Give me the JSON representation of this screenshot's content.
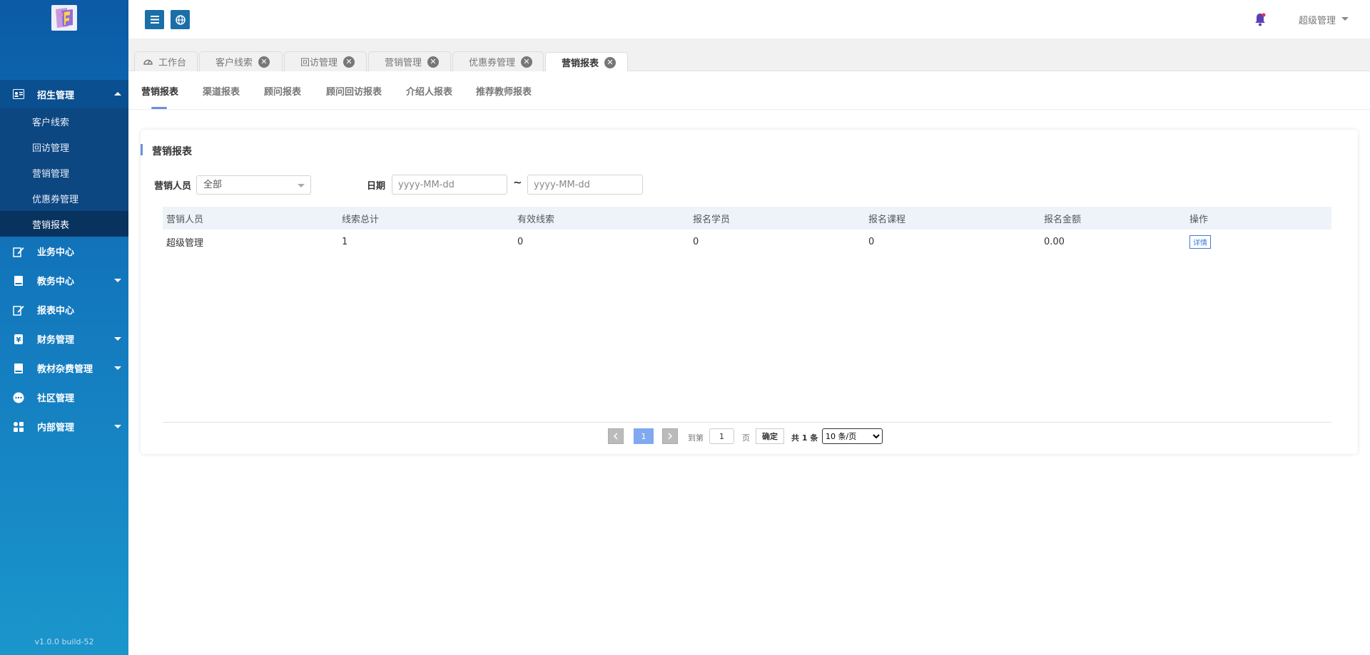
{
  "sidebar": {
    "version": "v1.0.0 build-52",
    "group": {
      "label": "招生管理",
      "items": [
        "客户线索",
        "回访管理",
        "营销管理",
        "优惠券管理",
        "营销报表"
      ]
    },
    "items": [
      {
        "label": "业务中心"
      },
      {
        "label": "教务中心"
      },
      {
        "label": "报表中心"
      },
      {
        "label": "财务管理"
      },
      {
        "label": "教材杂费管理"
      },
      {
        "label": "社区管理"
      },
      {
        "label": "内部管理"
      }
    ]
  },
  "header": {
    "user": "超级管理"
  },
  "tabs": [
    "工作台",
    "客户线索",
    "回访管理",
    "营销管理",
    "优惠券管理",
    "营销报表"
  ],
  "subtabs": [
    "营销报表",
    "渠道报表",
    "顾问报表",
    "顾问回访报表",
    "介绍人报表",
    "推荐教师报表"
  ],
  "card": {
    "title": "营销报表",
    "filter": {
      "staff_label": "营销人员",
      "staff_value": "全部",
      "date_label": "日期",
      "date_start_placeholder": "yyyy-MM-dd",
      "date_sep": "~",
      "date_end_placeholder": "yyyy-MM-dd"
    },
    "table": {
      "headers": [
        "营销人员",
        "线索总计",
        "有效线索",
        "报名学员",
        "报名课程",
        "报名金额",
        "操作"
      ],
      "rows": [
        {
          "staff": "超级管理",
          "leads": "1",
          "valid": "0",
          "students": "0",
          "courses": "0",
          "amount": "0.00",
          "action": "详情"
        }
      ]
    },
    "pager": {
      "current": "1",
      "goto_label": "到第",
      "goto_value": "1",
      "page_unit": "页",
      "confirm": "确定",
      "total": "共 1 条",
      "size": "10 条/页"
    }
  },
  "colors": {
    "primary": "#1b6fa8",
    "accent": "#6a8fe0",
    "amount": "#1b8a8a"
  }
}
